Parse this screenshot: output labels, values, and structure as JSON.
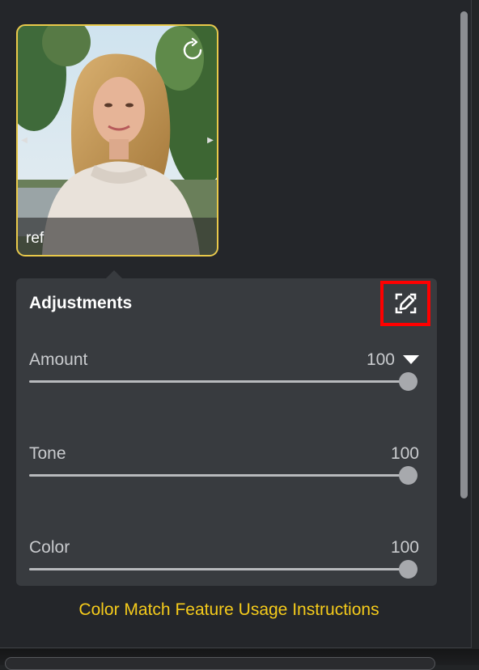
{
  "reference": {
    "label": "ref",
    "photo_description_icon": "portrait-photo"
  },
  "adjustments": {
    "title": "Adjustments",
    "edit_icon": "edit-icon",
    "sliders": [
      {
        "label": "Amount",
        "value": "100",
        "has_dropdown": true,
        "level": 1.0
      },
      {
        "label": "Tone",
        "value": "100",
        "has_dropdown": false,
        "level": 1.0
      },
      {
        "label": "Color",
        "value": "100",
        "has_dropdown": false,
        "level": 1.0
      }
    ]
  },
  "help_link": "Color Match Feature Usage Instructions",
  "colors": {
    "accent": "#f5cb1b",
    "thumb_border": "#e9c94a",
    "highlight": "#ff0000",
    "card_bg": "#383b3f",
    "panel_bg": "#24262a"
  }
}
